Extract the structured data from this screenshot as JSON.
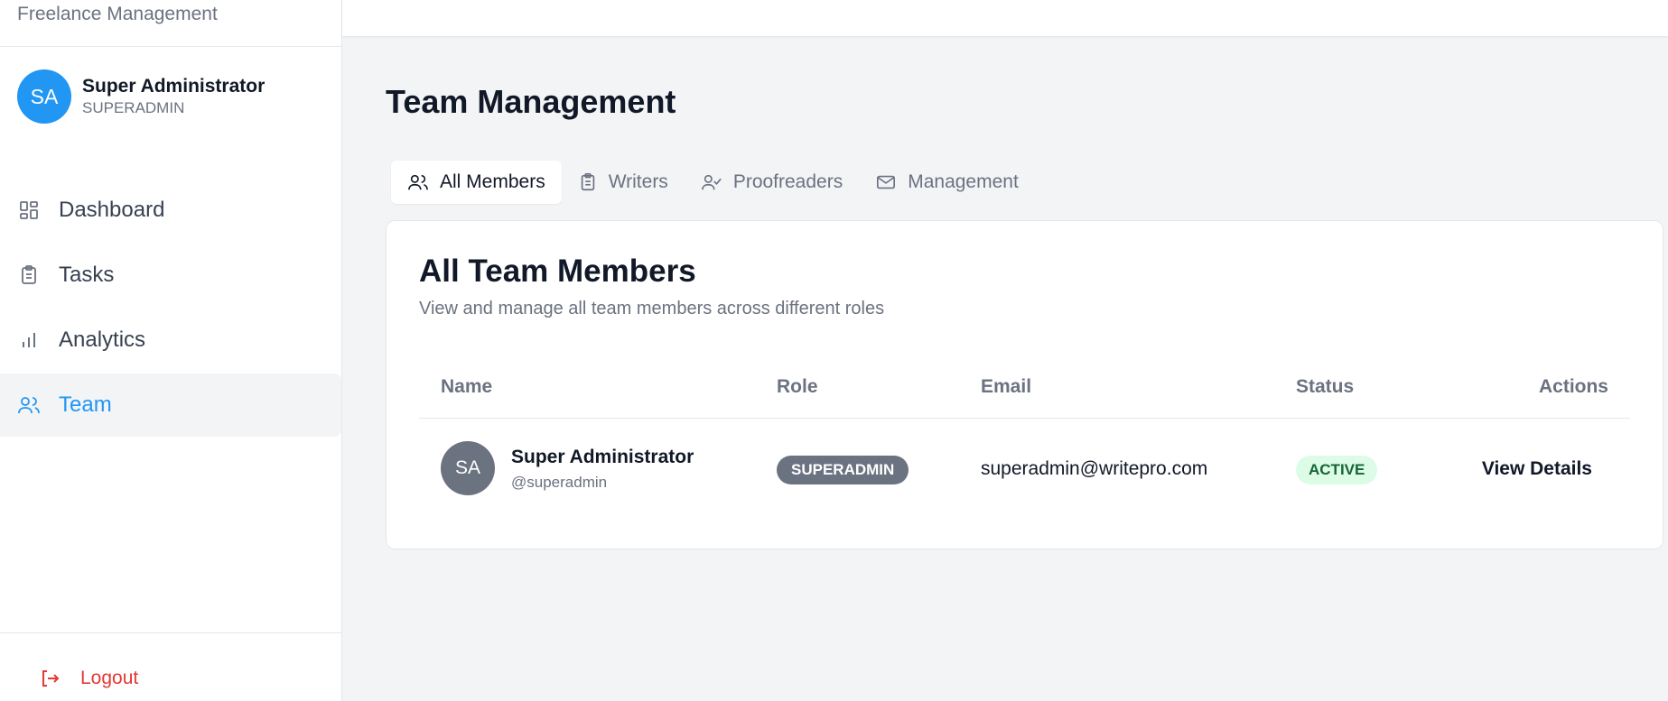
{
  "sidebar": {
    "brand": "Freelance Management",
    "user": {
      "initials": "SA",
      "name": "Super Administrator",
      "role": "SUPERADMIN"
    },
    "nav": [
      {
        "label": "Dashboard",
        "icon": "dashboard-icon"
      },
      {
        "label": "Tasks",
        "icon": "clipboard-icon"
      },
      {
        "label": "Analytics",
        "icon": "bar-chart-icon"
      },
      {
        "label": "Team",
        "icon": "users-icon",
        "active": true
      }
    ],
    "logout_label": "Logout"
  },
  "main": {
    "title": "Team Management",
    "tabs": [
      {
        "label": "All Members",
        "icon": "users-icon",
        "active": true
      },
      {
        "label": "Writers",
        "icon": "clipboard-icon"
      },
      {
        "label": "Proofreaders",
        "icon": "user-check-icon"
      },
      {
        "label": "Management",
        "icon": "mail-icon"
      }
    ],
    "card": {
      "title": "All Team Members",
      "subtitle": "View and manage all team members across different roles",
      "columns": [
        "Name",
        "Role",
        "Email",
        "Status",
        "Actions"
      ],
      "rows": [
        {
          "initials": "SA",
          "name": "Super Administrator",
          "username": "@superadmin",
          "role": "SUPERADMIN",
          "email": "superadmin@writepro.com",
          "status": "ACTIVE",
          "action": "View Details"
        }
      ]
    }
  },
  "colors": {
    "accent": "#2196f3",
    "logout": "#e53935",
    "role_badge": "#6b7280",
    "status_bg": "#dcfce7",
    "status_text": "#166534"
  }
}
